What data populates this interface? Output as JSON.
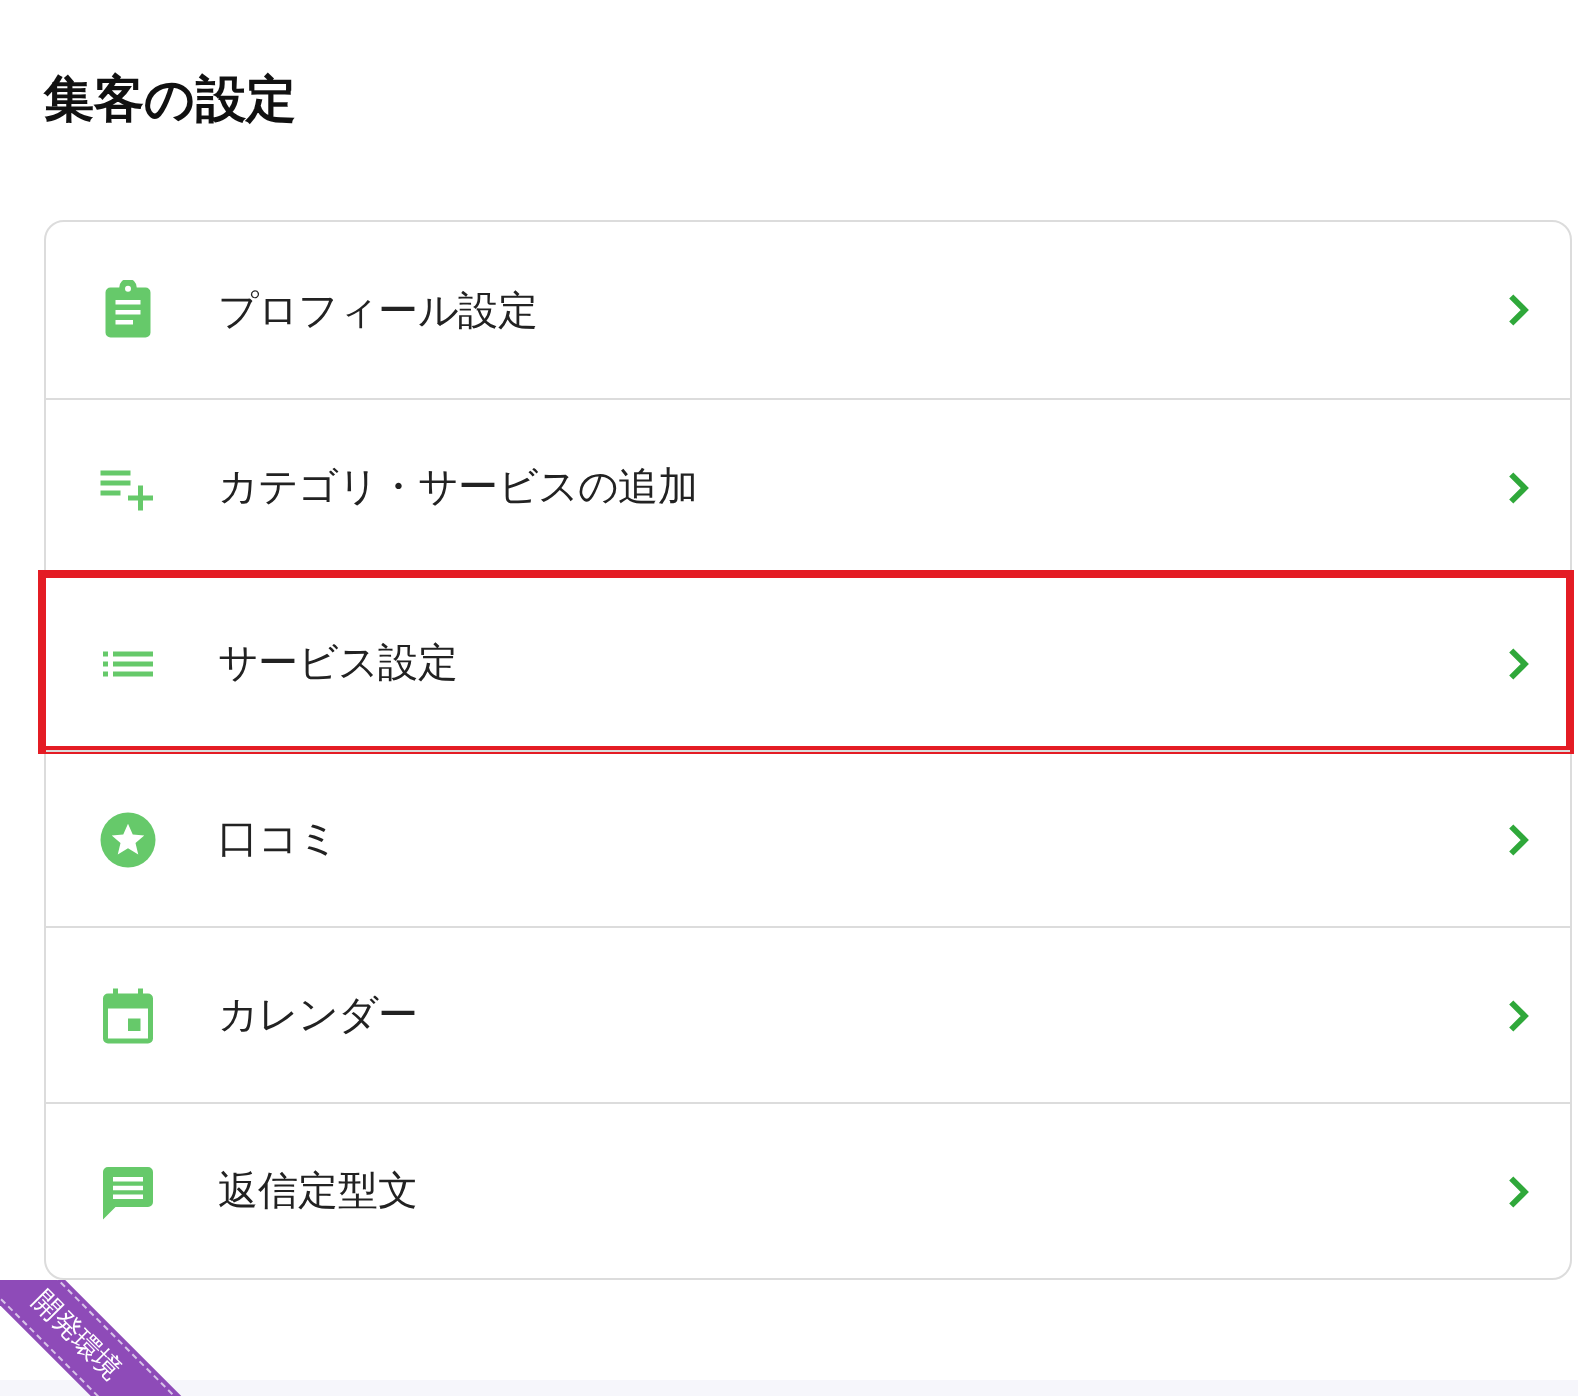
{
  "title": "集客の設定",
  "items": [
    {
      "label": "プロフィール設定",
      "highlighted": false
    },
    {
      "label": "カテゴリ・サービスの追加",
      "highlighted": false
    },
    {
      "label": "サービス設定",
      "highlighted": true
    },
    {
      "label": "口コミ",
      "highlighted": false
    },
    {
      "label": "カレンダー",
      "highlighted": false
    },
    {
      "label": "返信定型文",
      "highlighted": false
    }
  ],
  "ribbon": {
    "label": "開発環境"
  }
}
